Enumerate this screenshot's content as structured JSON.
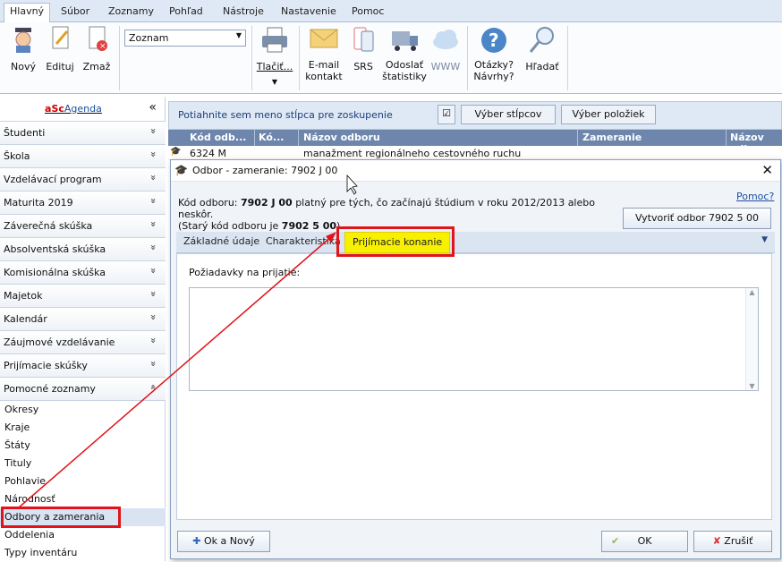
{
  "menu": {
    "tabs": [
      "Hlavný",
      "Súbor",
      "Zoznamy",
      "Pohľad",
      "Nástroje",
      "Nastavenie",
      "Pomoc"
    ]
  },
  "ribbon": {
    "novy": "Nový",
    "edituj": "Edituj",
    "zmaz": "Zmaž",
    "dropdown": "Zoznam",
    "tlacit": "Tlačiť...",
    "email": "E-mail",
    "kontakt": "kontakt",
    "srs": "SRS",
    "odoslat": "Odoslať",
    "statistiky": "štatistiky",
    "www": "WWW",
    "otazky": "Otázky?",
    "navrhy": "Návrhy?",
    "hladat": "Hľadať"
  },
  "sidebar": {
    "brand_a": "a",
    "brand_sc": "Sc",
    "brand_agenda": "Agenda",
    "collapse": "«",
    "sections": [
      "Študenti",
      "Škola",
      "Vzdelávací program",
      "Maturita 2019",
      "Záverečná skúška",
      "Absolventská skúška",
      "Komisionálna skúška",
      "Majetok",
      "Kalendár",
      "Záujmové vzdelávanie",
      "Prijímacie skúšky",
      "Pomocné zoznamy"
    ],
    "subitems": [
      "Okresy",
      "Kraje",
      "Štáty",
      "Tituly",
      "Pohlavie",
      "Národnosť",
      "Odbory a zamerania",
      "Oddelenia",
      "Typy inventáru"
    ]
  },
  "grid": {
    "group_hint": "Potiahnite sem meno stĺpca pre zoskupenie",
    "btn_columns": "Výber stĺpcov",
    "btn_items": "Výber položiek",
    "headers": [
      "Kód odb...",
      "Kó...",
      "Názov odboru",
      "Zameranie",
      "Názov odb"
    ],
    "row_code": "6324 M",
    "row_name": "manažment regionálneho cestovného ruchu"
  },
  "dialog": {
    "title": "Odbor - zameranie: 7902 J 00",
    "kod_prefix": "Kód odboru:",
    "kod_value": "7902 J 00",
    "kod_suffix": "platný pre tých, čo začínajú štúdium v roku 2012/2013 alebo neskôr.",
    "stary_prefix": "(Starý kód odboru je",
    "stary_value": "7902 5 00",
    "stary_suffix": ")",
    "help": "Pomoc?",
    "create_btn": "Vytvoriť odbor 7902 5 00",
    "tabs": [
      "Základné údaje",
      "Charakteristika",
      "Prijímacie konanie"
    ],
    "requirements_label": "Požiadavky na prijatie:",
    "ok_new": "Ok a Nový",
    "ok": "OK",
    "cancel": "Zrušiť"
  }
}
